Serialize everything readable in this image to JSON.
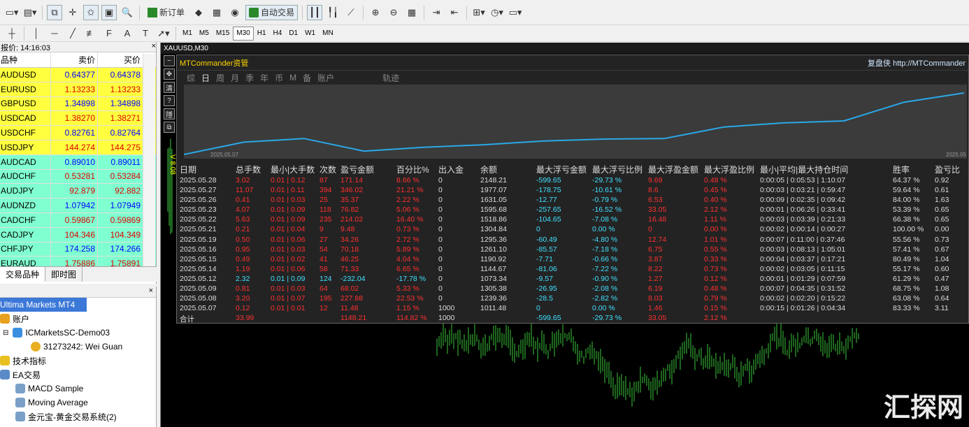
{
  "toolbar1": {
    "new_order": "新订单",
    "auto_trade": "自动交易"
  },
  "timeframes": [
    "M1",
    "M5",
    "M15",
    "M30",
    "H1",
    "H4",
    "D1",
    "W1",
    "MN"
  ],
  "active_timeframe": "M30",
  "market_watch": {
    "header": "报价: 14:16:03",
    "col_symbol": "品种",
    "col_bid": "卖价",
    "col_ask": "买价",
    "rows": [
      {
        "s": "AUDUSD",
        "b": "0.64377",
        "a": "0.64378",
        "bg": "#ffff40"
      },
      {
        "s": "EURUSD",
        "b": "1.13233",
        "a": "1.13233",
        "bg": "#ffff40"
      },
      {
        "s": "GBPUSD",
        "b": "1.34898",
        "a": "1.34898",
        "bg": "#ffff40"
      },
      {
        "s": "USDCAD",
        "b": "1.38270",
        "a": "1.38271",
        "bg": "#ffff40"
      },
      {
        "s": "USDCHF",
        "b": "0.82761",
        "a": "0.82764",
        "bg": "#ffff40"
      },
      {
        "s": "USDJPY",
        "b": "144.274",
        "a": "144.275",
        "bg": "#ffff40"
      },
      {
        "s": "AUDCAD",
        "b": "0.89010",
        "a": "0.89011",
        "bg": "#80ffd0"
      },
      {
        "s": "AUDCHF",
        "b": "0.53281",
        "a": "0.53284",
        "bg": "#80ffd0"
      },
      {
        "s": "AUDJPY",
        "b": "92.879",
        "a": "92.882",
        "bg": "#80ffd0"
      },
      {
        "s": "AUDNZD",
        "b": "1.07942",
        "a": "1.07949",
        "bg": "#80ffd0"
      },
      {
        "s": "CADCHF",
        "b": "0.59867",
        "a": "0.59869",
        "bg": "#80ffd0"
      },
      {
        "s": "CADJPY",
        "b": "104.346",
        "a": "104.349",
        "bg": "#80ffd0"
      },
      {
        "s": "CHFJPY",
        "b": "174.258",
        "a": "174.266",
        "bg": "#80ffd0"
      },
      {
        "s": "EURAUD",
        "b": "1.75886",
        "a": "1.75891",
        "bg": "#80ffd0"
      }
    ],
    "tabs": [
      "交易品种",
      "即时图"
    ]
  },
  "navigator": {
    "root": "Ultima Markets MT4",
    "accounts": "账户",
    "server": "ICMarketsSC-Demo03",
    "account": "31273242: Wei Guan",
    "indicators": "技术指标",
    "ea": "EA交易",
    "ea_items": [
      "MACD Sample",
      "Moving Average",
      "金元宝-黄金交易系统(2)"
    ]
  },
  "chart": {
    "title": "XAUUSD,M30",
    "vlabel": "V 8.08"
  },
  "panel": {
    "title": "MTCommander资管",
    "brand": "复盘侠 http://MTCommander",
    "tabs": [
      "综",
      "日",
      "周",
      "月",
      "季",
      "年",
      "币",
      "M",
      "备",
      "账户",
      "轨迹"
    ],
    "active_tab": "日",
    "perf_start": "2025.05.07",
    "perf_end": "2025.05",
    "headers": [
      "日期",
      "总手数",
      "最小|大手数",
      "次数",
      "盈亏金额",
      "百分比%",
      "出入金",
      "余额",
      "最大浮亏金额",
      "最大浮亏比例",
      "最大浮盈金额",
      "最大浮盈比例",
      "最小|平均|最大持仓时间",
      "胜率",
      "盈亏比"
    ],
    "rows": [
      [
        "2025.05.28",
        "3.02",
        "0.01 | 0.12",
        "87",
        "171.14",
        "8.66 %",
        "0",
        "2148.21",
        "-599.65",
        "-29.73 %",
        "9.69",
        "0.48 %",
        "0:00:05 | 0:05:53 | 1:10:07",
        "64.37 %",
        "0.92"
      ],
      [
        "2025.05.27",
        "11.07",
        "0.01 | 0.11",
        "394",
        "346.02",
        "21.21 %",
        "0",
        "1977.07",
        "-178.75",
        "-10.61 %",
        "8.6",
        "0.45 %",
        "0:00:03 | 0:03:21 | 0:59:47",
        "59.64 %",
        "0.61"
      ],
      [
        "2025.05.26",
        "0.41",
        "0.01 | 0.03",
        "25",
        "35.37",
        "2.22 %",
        "0",
        "1631.05",
        "-12.77",
        "-0.79 %",
        "6.53",
        "0.40 %",
        "0:00:09 | 0:02:35 | 0:09:42",
        "84.00 %",
        "1.63"
      ],
      [
        "2025.05.23",
        "4.07",
        "0.01 | 0.09",
        "118",
        "76.82",
        "5.06 %",
        "0",
        "1595.68",
        "-257.65",
        "-16.52 %",
        "33.05",
        "2.12 %",
        "0:00:01 | 0:06:26 | 0:33:41",
        "53.39 %",
        "0.65"
      ],
      [
        "2025.05.22",
        "5.63",
        "0.01 | 0.09",
        "235",
        "214.02",
        "16.40 %",
        "0",
        "1518.86",
        "-104.65",
        "-7.08 %",
        "16.48",
        "1.11 %",
        "0:00:03 | 0:03:39 | 0:21:33",
        "66.38 %",
        "0.65"
      ],
      [
        "2025.05.21",
        "0.21",
        "0.01 | 0.04",
        "9",
        "9.48",
        "0.73 %",
        "0",
        "1304.84",
        "0",
        "0.00 %",
        "0",
        "0.00 %",
        "0:00:02 | 0:00:14 | 0:00:27",
        "100.00 %",
        "0.00"
      ],
      [
        "2025.05.19",
        "0.50",
        "0.01 | 0.06",
        "27",
        "34.26",
        "2.72 %",
        "0",
        "1295.36",
        "-60.49",
        "-4.80 %",
        "12.74",
        "1.01 %",
        "0:00:07 | 0:11:00 | 0:37:46",
        "55.56 %",
        "0.73"
      ],
      [
        "2025.05.16",
        "0.95",
        "0.01 | 0.03",
        "54",
        "70.18",
        "5.89 %",
        "0",
        "1261.10",
        "-85.57",
        "-7.18 %",
        "6.75",
        "0.55 %",
        "0:00:03 | 0:08:13 | 1:05:01",
        "57.41 %",
        "0.67"
      ],
      [
        "2025.05.15",
        "0.49",
        "0.01 | 0.02",
        "41",
        "46.25",
        "4.04 %",
        "0",
        "1190.92",
        "-7.71",
        "-0.66 %",
        "3.87",
        "0.33 %",
        "0:00:04 | 0:03:37 | 0:17:21",
        "80.49 %",
        "1.04"
      ],
      [
        "2025.05.14",
        "1.19",
        "0.01 | 0.06",
        "58",
        "71.33",
        "6.65 %",
        "0",
        "1144.67",
        "-81.06",
        "-7.22 %",
        "8.22",
        "0.73 %",
        "0:00:02 | 0:03:05 | 0:11:15",
        "55.17 %",
        "0.60"
      ],
      [
        "2025.05.12",
        "2.32",
        "0.01 | 0.09",
        "124",
        "-232.04",
        "-17.78 %",
        "0",
        "1073.34",
        "-9.57",
        "-0.90 %",
        "1.27",
        "0.12 %",
        "0:00:01 | 0:01:29 | 0:07:59",
        "61.29 %",
        "0.47"
      ],
      [
        "2025.05.09",
        "0.81",
        "0.01 | 0.03",
        "64",
        "68.02",
        "5.33 %",
        "0",
        "1305.38",
        "-26.95",
        "-2.08 %",
        "6.19",
        "0.48 %",
        "0:00:07 | 0:04:35 | 0:31:52",
        "68.75 %",
        "1.08"
      ],
      [
        "2025.05.08",
        "3.20",
        "0.01 | 0.07",
        "195",
        "227.88",
        "22.53 %",
        "0",
        "1239.36",
        "-28.5",
        "-2.82 %",
        "8.03",
        "0.79 %",
        "0:00:02 | 0:02:20 | 0:15:22",
        "63.08 %",
        "0.64"
      ],
      [
        "2025.05.07",
        "0.12",
        "0.01 | 0.01",
        "12",
        "11.48",
        "1.15 %",
        "1000",
        "1011.48",
        "0",
        "0.00 %",
        "1.46",
        "0.15 %",
        "0:00:15 | 0:01:26 | 0:04:34",
        "83.33 %",
        "3.11"
      ]
    ],
    "total": [
      "合计",
      "33.99",
      "",
      "",
      "1148.21",
      "114.82 %",
      "1000",
      "",
      "-599.65",
      "-29.73 %",
      "33.05",
      "2.12 %",
      "",
      "",
      ""
    ],
    "row_colors": [
      "wh",
      "rd",
      "rd",
      "rd",
      "rd",
      "rd",
      "wh",
      "wh",
      "cy",
      "cy",
      "rd",
      "rd",
      "wh",
      "wh",
      "wh"
    ]
  },
  "equity_curve": [
    1011.48,
    1239.36,
    1305.38,
    1073.34,
    1144.67,
    1190.92,
    1261.1,
    1295.36,
    1304.84,
    1518.86,
    1595.68,
    1631.05,
    1977.07,
    2148.21
  ],
  "watermark": "汇探网"
}
